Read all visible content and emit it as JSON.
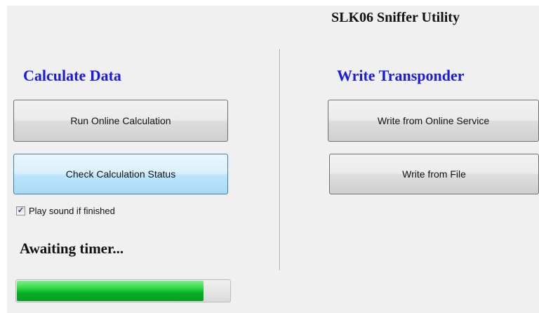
{
  "app": {
    "title": "SLK06 Sniffer Utility"
  },
  "calculate": {
    "heading": "Calculate Data",
    "run_button": "Run Online Calculation",
    "check_button": "Check Calculation Status",
    "play_sound": {
      "label": "Play sound if finished",
      "checked": true
    },
    "status_text": "Awaiting timer...",
    "progress_fraction": 0.88
  },
  "write": {
    "heading": "Write Transponder",
    "online_button": "Write from Online Service",
    "file_button": "Write from File"
  },
  "colors": {
    "heading_blue": "#1a1ae6",
    "progress_green": "#06b025",
    "hover_blue": "#3c7fb1"
  },
  "icons": {
    "checkbox_mark": "check-icon"
  }
}
